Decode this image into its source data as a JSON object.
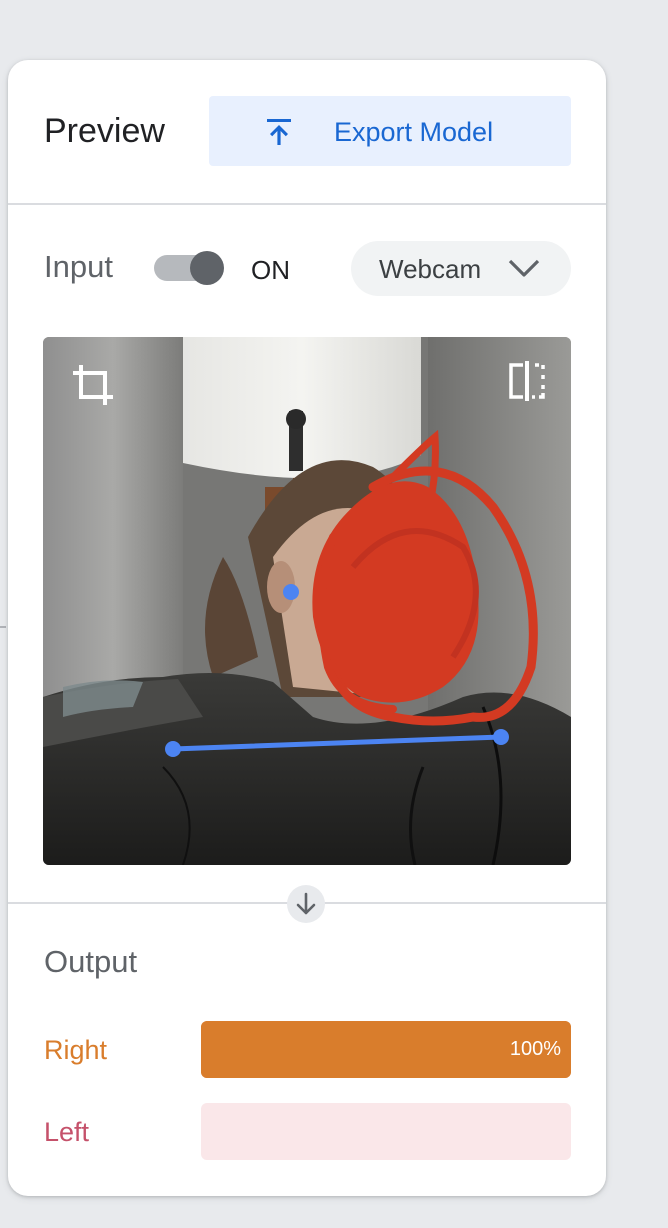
{
  "header": {
    "title": "Preview",
    "export_label": "Export Model"
  },
  "input": {
    "label": "Input",
    "toggle_on": true,
    "toggle_state": "ON",
    "source": "Webcam"
  },
  "output": {
    "title": "Output",
    "classes": [
      {
        "label": "Right",
        "percent_text": "100%",
        "confidence": 1.0,
        "color": "#d97d2c",
        "track_color": "#d97d2c"
      },
      {
        "label": "Left",
        "percent_text": "",
        "confidence": 0.0,
        "color": "#c5516a",
        "track_color": "#fae7e9"
      }
    ]
  },
  "colors": {
    "accent_blue": "#1967d2",
    "export_bg": "#e8f0fe",
    "pose_keypoint": "#4c84f2",
    "redaction": "#d33a22"
  },
  "icons": {
    "export": "upload-arrow-icon",
    "crop": "crop-icon",
    "flip": "flip-horizontal-icon",
    "chevron": "chevron-down-icon",
    "flow": "arrow-down-icon"
  }
}
